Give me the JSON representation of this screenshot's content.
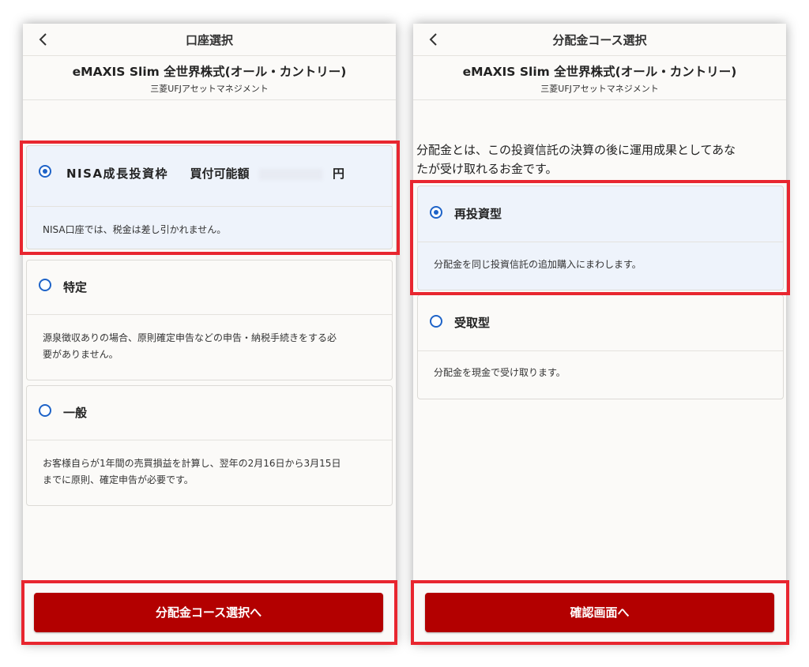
{
  "left": {
    "header_title": "口座選択",
    "fund_name": "eMAXIS Slim 全世界株式(オール・カントリー)",
    "fund_company": "三菱UFJアセットマネジメント",
    "options": [
      {
        "label": "NISA成長投資枠",
        "purchasable_label": "買付可能額",
        "yen": "円",
        "description": "NISA口座では、税金は差し引かれません。",
        "selected": true
      },
      {
        "label": "特定",
        "description_line1": "源泉徴収ありの場合、原則確定申告などの申告・納税手続きをする必",
        "description_line2": "要がありません。",
        "selected": false
      },
      {
        "label": "一般",
        "description_line1": "お客様自らが1年間の売買損益を計算し、翌年の2月16日から3月15日",
        "description_line2": "までに原則、確定申告が必要です。",
        "selected": false
      }
    ],
    "cta_label": "分配金コース選択へ"
  },
  "right": {
    "header_title": "分配金コース選択",
    "fund_name": "eMAXIS Slim 全世界株式(オール・カントリー)",
    "fund_company": "三菱UFJアセットマネジメント",
    "intro_line1": "分配金とは、この投資信託の決算の後に運用成果としてあな",
    "intro_line2": "たが受け取れるお金です。",
    "options": [
      {
        "label": "再投資型",
        "description": "分配金を同じ投資信託の追加購入にまわします。",
        "selected": true
      },
      {
        "label": "受取型",
        "description": "分配金を現金で受け取ります。",
        "selected": false
      }
    ],
    "cta_label": "確認画面へ"
  },
  "colors": {
    "accent": "#b30000",
    "highlight": "#e8262f",
    "radio": "#1e63c8",
    "selected_bg": "#eef3fb"
  },
  "icons": {
    "back": "chevron-left-icon"
  }
}
